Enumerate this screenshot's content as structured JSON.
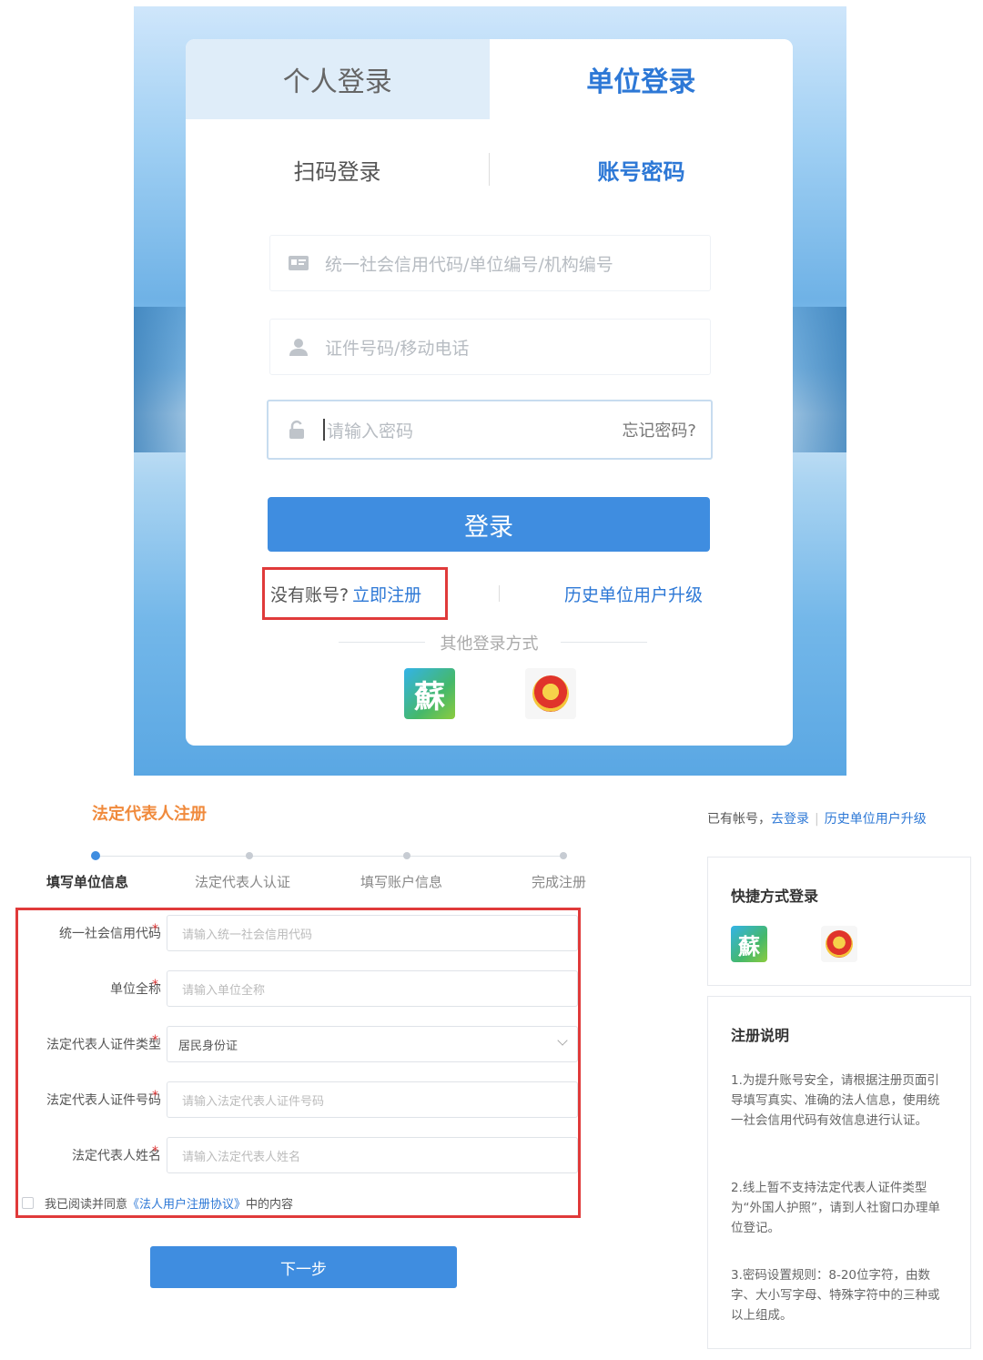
{
  "login": {
    "tabs": [
      {
        "label": "个人登录",
        "active": false
      },
      {
        "label": "单位登录",
        "active": true
      }
    ],
    "sub_tabs": [
      {
        "label": "扫码登录",
        "active": false
      },
      {
        "label": "账号密码",
        "active": true
      }
    ],
    "fields": {
      "credit_code_placeholder": "统一社会信用代码/单位编号/机构编号",
      "id_phone_placeholder": "证件号码/移动电话",
      "password_placeholder": "请输入密码",
      "forgot_password": "忘记密码?"
    },
    "login_button": "登录",
    "no_account_text": "没有账号?",
    "register_link": "立即注册",
    "upgrade_link": "历史单位用户升级",
    "other_methods_title": "其他登录方式",
    "su_logo_char": "蘇"
  },
  "register": {
    "title": "法定代表人注册",
    "already_text": "已有帐号，",
    "login_link": "去登录",
    "upgrade_link": "历史单位用户升级",
    "steps": [
      {
        "label": "填写单位信息",
        "active": true
      },
      {
        "label": "法定代表人认证",
        "active": false
      },
      {
        "label": "填写账户信息",
        "active": false
      },
      {
        "label": "完成注册",
        "active": false
      }
    ],
    "form": [
      {
        "label": "统一社会信用代码",
        "required": "*",
        "placeholder": "请输入统一社会信用代码"
      },
      {
        "label": "单位全称",
        "required": "*",
        "placeholder": "请输入单位全称"
      },
      {
        "label": "法定代表人证件类型",
        "required": "*",
        "value": "居民身份证"
      },
      {
        "label": "法定代表人证件号码",
        "required": "*",
        "placeholder": "请输入法定代表人证件号码"
      },
      {
        "label": "法定代表人姓名",
        "required": "*",
        "placeholder": "请输入法定代表人姓名"
      }
    ],
    "agree_prefix": "我已阅读并同意",
    "agree_link": "《法人用户注册协议》",
    "agree_suffix": "中的内容",
    "next_button": "下一步",
    "quick_login_title": "快捷方式登录",
    "su_logo_char": "蘇",
    "notes_title": "注册说明",
    "notes": [
      "1.为提升账号安全，请根据注册页面引导填写真实、准确的法人信息，使用统一社会信用代码有效信息进行认证。",
      "2.线上暂不支持法定代表人证件类型为“外国人护照”，请到人社窗口办理单位登记。",
      "3.密码设置规则：8-20位字符，由数字、大小写字母、特殊字符中的三种或以上组成。"
    ]
  },
  "colors": {
    "accent": "#3f8de0",
    "highlight_border": "#e03a3a",
    "title_orange": "#f08a3c"
  }
}
